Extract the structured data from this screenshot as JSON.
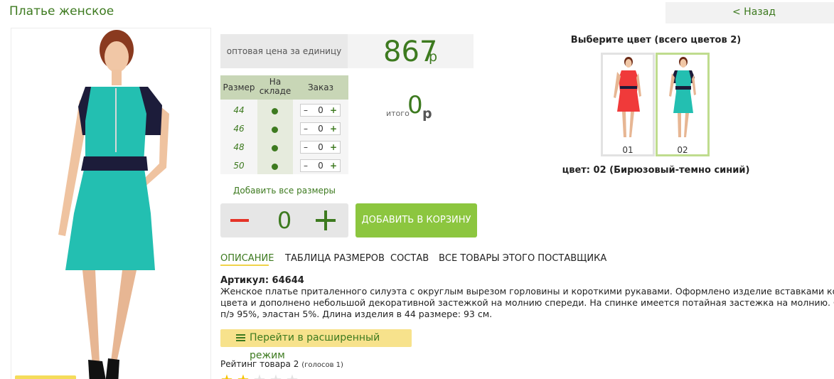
{
  "header": {
    "title": "Платье женское",
    "back_label": "< Назад"
  },
  "price": {
    "label": "оптовая цена за единицу",
    "value": "867",
    "currency": "р"
  },
  "size_table": {
    "headers": {
      "size": "Размер",
      "stock": "На складе",
      "order": "Заказ"
    },
    "rows": [
      {
        "size": "44",
        "in_stock": true,
        "qty": "0"
      },
      {
        "size": "46",
        "in_stock": true,
        "qty": "0"
      },
      {
        "size": "48",
        "in_stock": true,
        "qty": "0"
      },
      {
        "size": "50",
        "in_stock": true,
        "qty": "0"
      }
    ],
    "minus": "–",
    "plus": "+"
  },
  "total": {
    "label": "итого",
    "value": "0",
    "currency": "р"
  },
  "add_all_sizes": "Добавить все размеры",
  "quantity": {
    "value": "0"
  },
  "cart_button": "ДОБАВИТЬ В КОРЗИНУ",
  "colors": {
    "heading": "Выберите цвет (всего цветов 2)",
    "items": [
      {
        "label": "01",
        "dress_color": "#f03a3a",
        "accent": "#1c1c3a"
      },
      {
        "label": "02",
        "dress_color": "#23bfb1",
        "accent": "#1c1c3a"
      }
    ],
    "selected": "цвет: 02 (Бирюзовый-темно синий)"
  },
  "tabs": [
    {
      "label": "ОПИСАНИЕ",
      "active": true
    },
    {
      "label": "ТАБЛИЦА РАЗМЕРОВ",
      "active": false
    },
    {
      "label": "СОСТАВ",
      "active": false
    },
    {
      "label": "ВСЕ ТОВАРЫ ЭТОГО ПОСТАВЩИКА",
      "active": false
    }
  ],
  "description": {
    "article": "Артикул: 64644",
    "lines": [
      "Женское платье приталенного силуэта с округлым вырезом горловины и короткими рукавами. Оформлено изделие вставками контрастного",
      "цвета и дополнено небольшой декоративной застежкой на молнию спереди. На спинке имеется потайная застежка на молнию. Состав ткани:",
      "п/э 95%, эластан 5%. Длина изделия в 44 размере: 93 см."
    ]
  },
  "advanced_mode_button": "Перейти в расширенный режим",
  "rating": {
    "label": "Рейтинг товара 2",
    "votes": "(голосов 1)",
    "value": 2,
    "max": 5
  },
  "theme": {
    "accent_green": "#3d7a1f",
    "button_green": "#8cc63f",
    "minus_red": "#e53327",
    "star_yellow": "#f5c400",
    "highlight_yellow": "#f7e28c"
  }
}
